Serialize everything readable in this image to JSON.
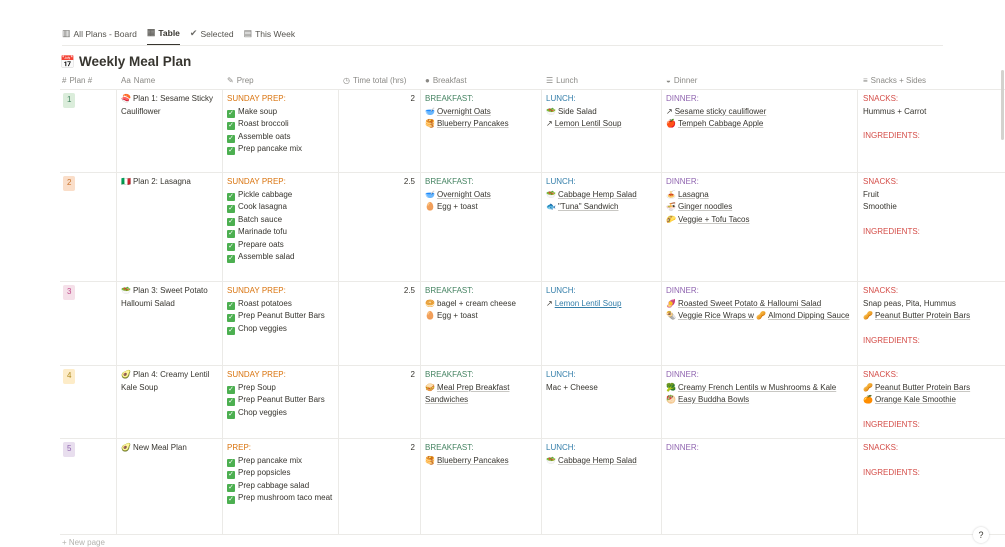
{
  "tabs": [
    {
      "label": "All Plans - Board",
      "icon": "board-icon"
    },
    {
      "label": "Table",
      "icon": "table-icon"
    },
    {
      "label": "Selected",
      "icon": "check-circle-icon"
    },
    {
      "label": "This Week",
      "icon": "calendar-icon"
    }
  ],
  "title": "Weekly Meal Plan",
  "columns": {
    "plan": "Plan #",
    "name": "Name",
    "prep": "Prep",
    "time": "Time total (hrs)",
    "breakfast": "Breakfast",
    "lunch": "Lunch",
    "dinner": "Dinner",
    "snacks": "Snacks + Sides"
  },
  "rows": [
    {
      "num": "1",
      "name_icon": "🍣",
      "name": "Plan 1: Sesame Sticky Cauliflower",
      "prep_header": "SUNDAY PREP:",
      "prep": [
        "Make soup",
        "Roast broccoli",
        "Assemble oats",
        "Prep pancake mix"
      ],
      "time": "2",
      "bf_header": "BREAKFAST:",
      "bf": [
        {
          "icon": "🥣",
          "text": "Overnight Oats",
          "link": true
        },
        {
          "icon": "🥞",
          "text": "Blueberry Pancakes",
          "link": true
        }
      ],
      "lu_header": "LUNCH:",
      "lu": [
        {
          "icon": "🥗",
          "text": "Side Salad",
          "link": false
        },
        {
          "icon": "↗",
          "text": "Lemon Lentil Soup",
          "link": true
        }
      ],
      "di_header": "DINNER:",
      "di": [
        {
          "icon": "↗",
          "text": "Sesame sticky cauliflower",
          "link": true
        },
        {
          "icon": "🍎",
          "text": "Tempeh Cabbage Apple",
          "link": true
        }
      ],
      "sn_header": "SNACKS:",
      "sn": [
        {
          "icon": "",
          "text": "Hummus + Carrot",
          "link": false
        }
      ],
      "ing": "INGREDIENTS:"
    },
    {
      "num": "2",
      "name_icon": "🇮🇹",
      "name": "Plan 2: Lasagna",
      "prep_header": "SUNDAY PREP:",
      "prep": [
        "Pickle cabbage",
        "Cook lasagna",
        "Batch sauce",
        "Marinade tofu",
        "Prepare oats",
        "Assemble salad"
      ],
      "time": "2.5",
      "bf_header": "BREAKFAST:",
      "bf": [
        {
          "icon": "🥣",
          "text": "Overnight Oats",
          "link": true
        },
        {
          "icon": "🥚",
          "text": "Egg + toast",
          "link": false
        }
      ],
      "lu_header": "LUNCH:",
      "lu": [
        {
          "icon": "🥗",
          "text": "Cabbage Hemp Salad",
          "link": true
        },
        {
          "icon": "🐟",
          "text": "\"Tuna\" Sandwich",
          "link": true
        }
      ],
      "di_header": "DINNER:",
      "di": [
        {
          "icon": "🍝",
          "text": "Lasagna",
          "link": true
        },
        {
          "icon": "🍜",
          "text": "Ginger noodles",
          "link": true
        },
        {
          "icon": "🌮",
          "text": "Veggie + Tofu Tacos",
          "link": true
        }
      ],
      "sn_header": "SNACKS:",
      "sn": [
        {
          "icon": "",
          "text": "Fruit",
          "link": false
        },
        {
          "icon": "",
          "text": "Smoothie",
          "link": false
        }
      ],
      "ing": "INGREDIENTS:"
    },
    {
      "num": "3",
      "name_icon": "🥗",
      "name": "Plan 3: Sweet Potato Halloumi Salad",
      "prep_header": "SUNDAY PREP:",
      "prep": [
        "Roast potatoes",
        "Prep Peanut Butter Bars",
        "Chop veggies"
      ],
      "time": "2.5",
      "bf_header": "BREAKFAST:",
      "bf": [
        {
          "icon": "🥯",
          "text": "bagel + cream cheese",
          "link": false
        },
        {
          "icon": "🥚",
          "text": "Egg + toast",
          "link": false
        }
      ],
      "lu_header": "LUNCH:",
      "lu": [
        {
          "icon": "↗",
          "text": "Lemon Lentil Soup",
          "link": true,
          "blue": true
        }
      ],
      "di_header": "DINNER:",
      "di": [
        {
          "icon": "🍠",
          "text": "Roasted Sweet Potato & Halloumi Salad",
          "link": true
        },
        {
          "icon": "🌯",
          "text": "Veggie Rice Wraps w",
          "link": true,
          "after_icon": "🥜",
          "after": "Almond Dipping Sauce"
        }
      ],
      "sn_header": "SNACKS:",
      "sn": [
        {
          "icon": "",
          "text": "Snap peas, Pita, Hummus",
          "link": false
        },
        {
          "icon": "🥜",
          "text": "Peanut Butter Protein Bars",
          "link": true
        }
      ],
      "ing": "INGREDIENTS:"
    },
    {
      "num": "4",
      "name_icon": "🥑",
      "name": "Plan 4: Creamy Lentil Kale Soup",
      "prep_header": "SUNDAY PREP:",
      "prep": [
        "Prep Soup",
        "Prep Peanut Butter Bars",
        "Chop veggies"
      ],
      "time": "2",
      "bf_header": "BREAKFAST:",
      "bf": [
        {
          "icon": "🥪",
          "text": "Meal Prep Breakfast Sandwiches",
          "link": true
        }
      ],
      "lu_header": "LUNCH:",
      "lu": [
        {
          "icon": "",
          "text": "Mac + Cheese",
          "link": false
        }
      ],
      "di_header": "DINNER:",
      "di": [
        {
          "icon": "🥦",
          "text": "Creamy  French Lentils w Mushrooms & Kale",
          "link": true
        },
        {
          "icon": "🥙",
          "text": "Easy Buddha Bowls",
          "link": true
        }
      ],
      "sn_header": "SNACKS:",
      "sn": [
        {
          "icon": "🥜",
          "text": "Peanut Butter Protein Bars",
          "link": true
        },
        {
          "icon": "🍊",
          "text": "Orange Kale Smoothie",
          "link": true
        }
      ],
      "ing": "INGREDIENTS:"
    },
    {
      "num": "5",
      "name_icon": "🥑",
      "name": "New Meal Plan",
      "prep_header": "PREP:",
      "prep": [
        "Prep pancake mix",
        "Prep popsicles",
        "Prep cabbage salad",
        "Prep mushroom taco meat"
      ],
      "time": "2",
      "bf_header": "BREAKFAST:",
      "bf": [
        {
          "icon": "🥞",
          "text": "Blueberry Pancakes",
          "link": true
        }
      ],
      "lu_header": "LUNCH:",
      "lu": [
        {
          "icon": "🥗",
          "text": "Cabbage Hemp Salad",
          "link": true
        }
      ],
      "di_header": "DINNER:",
      "di": [],
      "sn_header": "SNACKS:",
      "sn": [],
      "ing": "INGREDIENTS:"
    }
  ],
  "new_page": "+ New page",
  "colors": {
    "num1": "#dbeddb",
    "num2": "#fadec9",
    "num3": "#f5e0e9",
    "num4": "#fdecc8",
    "num5": "#e8deee"
  }
}
